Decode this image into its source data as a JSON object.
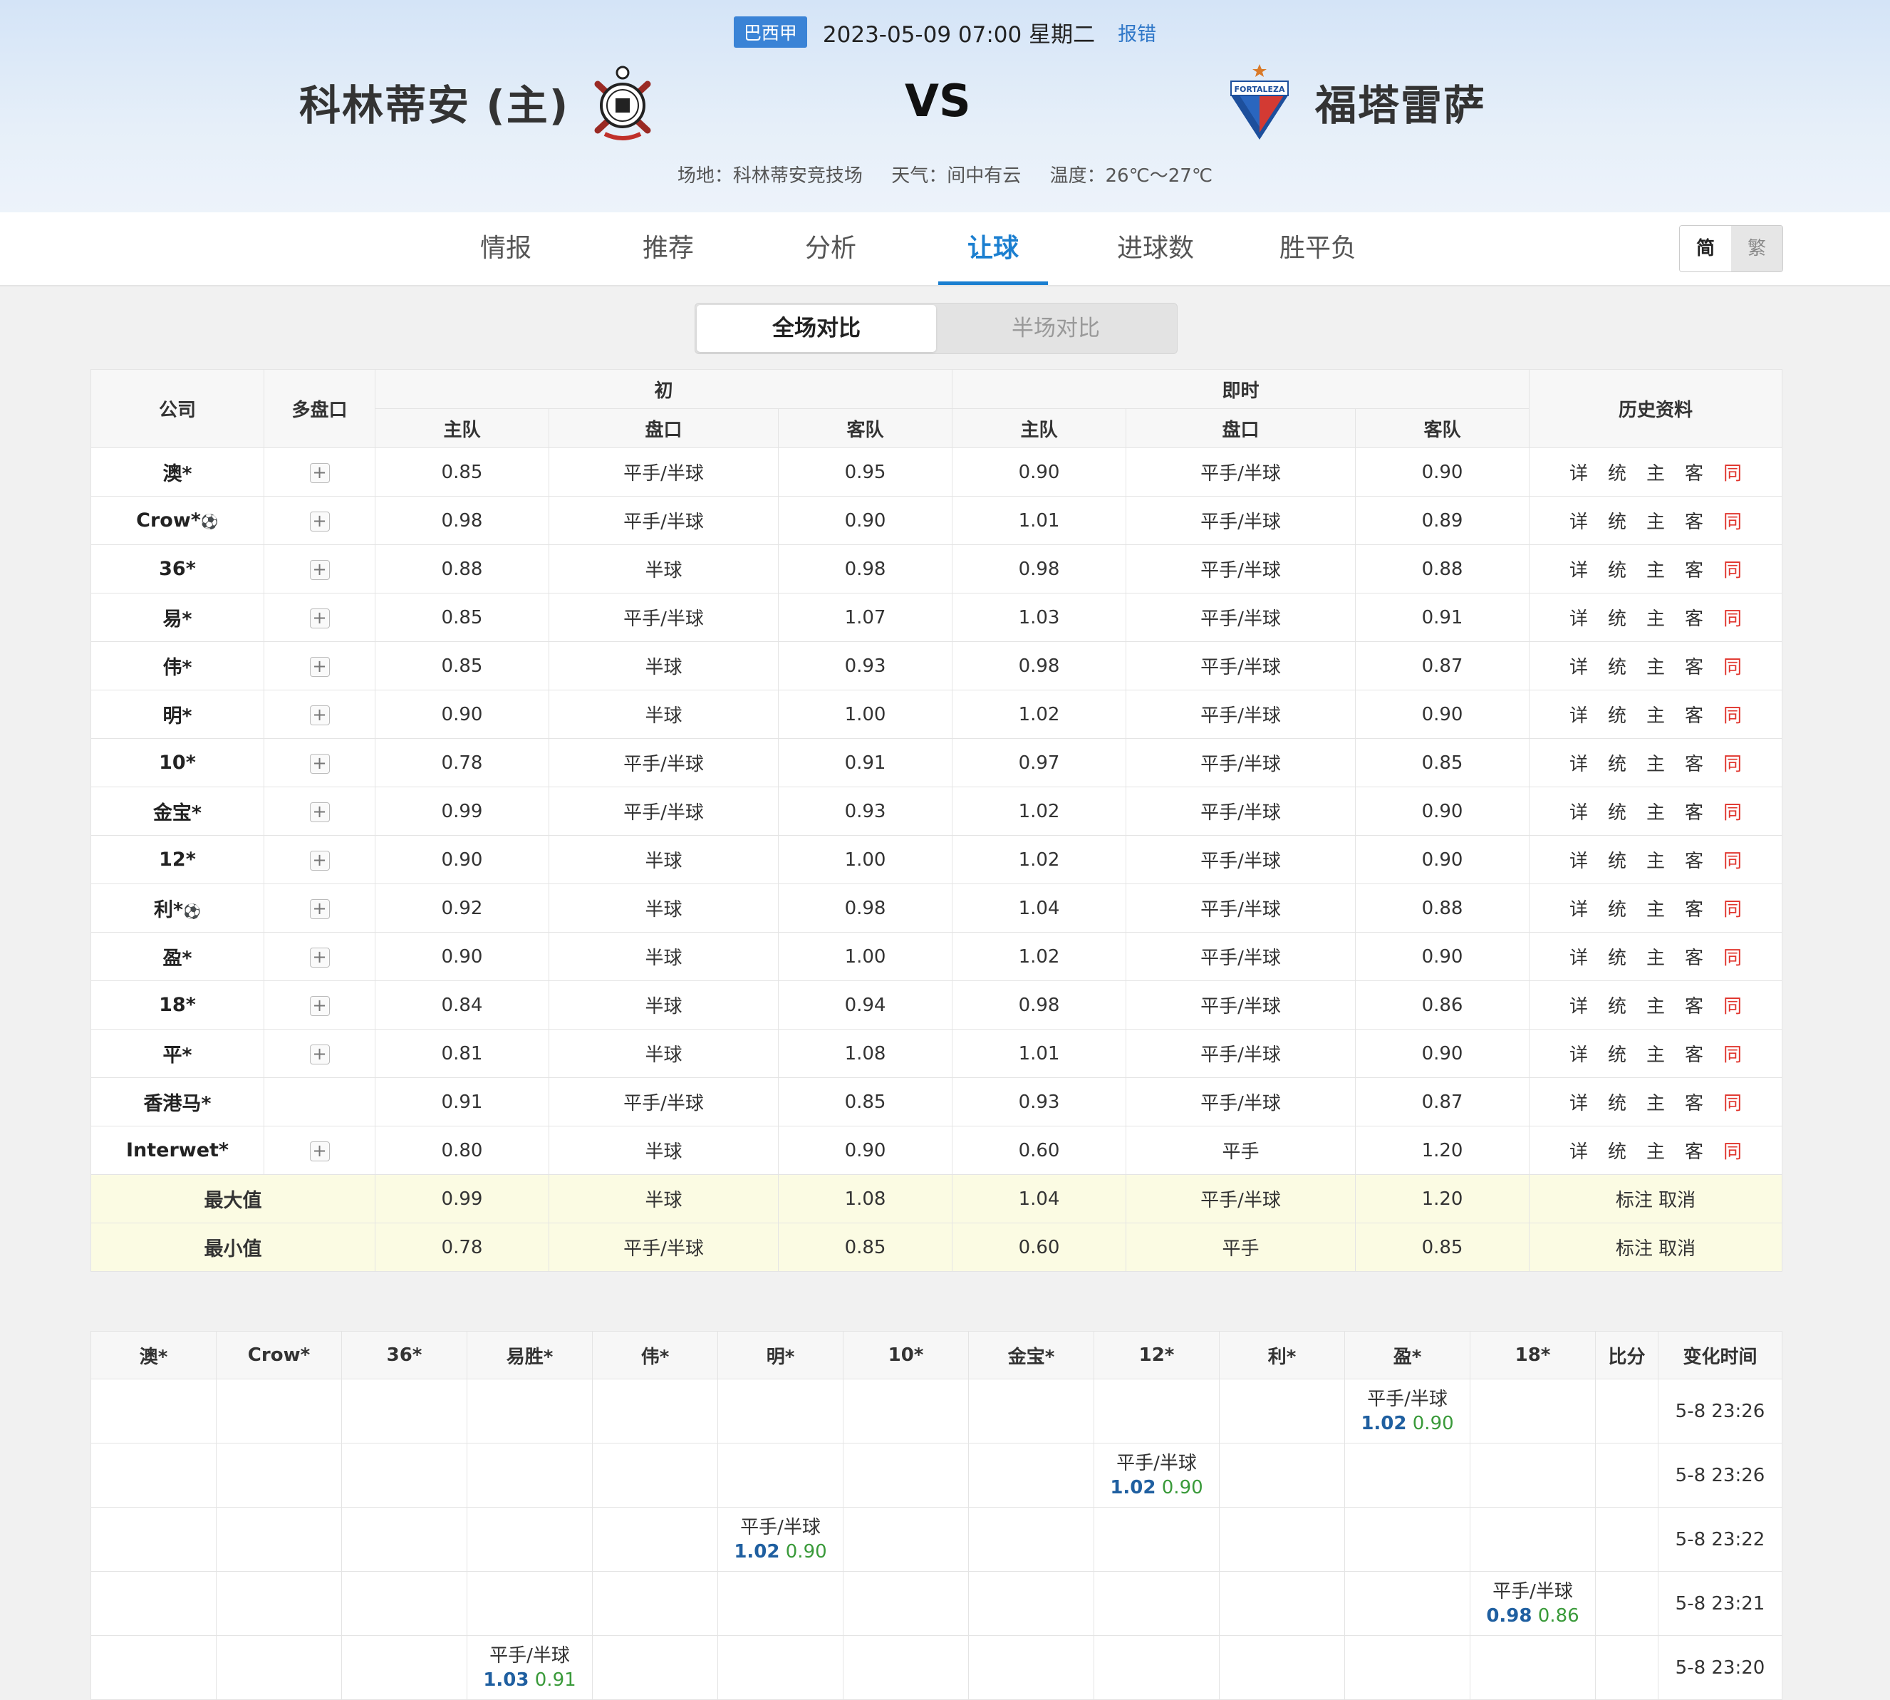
{
  "header": {
    "league": "巴西甲",
    "datetime": "2023-05-09 07:00 星期二",
    "report": "报错",
    "home_team": "科林蒂安 (主)",
    "away_team": "福塔雷萨",
    "vs": "VS",
    "venue": "场地：科林蒂安竞技场",
    "weather": "天气：间中有云",
    "temperature": "温度：26℃～27℃",
    "away_logo_text": "FORTALEZA"
  },
  "nav": {
    "tabs": [
      "情报",
      "推荐",
      "分析",
      "让球",
      "进球数",
      "胜平负"
    ],
    "active_tab": "让球",
    "lang_simplified": "简",
    "lang_traditional": "繁"
  },
  "segment": {
    "full": "全场对比",
    "half": "半场对比"
  },
  "odds_table": {
    "headers": {
      "company": "公司",
      "multi": "多盘口",
      "initial": "初",
      "live": "即时",
      "history": "历史资料",
      "home": "主队",
      "line": "盘口",
      "away": "客队"
    },
    "history_links": [
      "详",
      "统",
      "主",
      "客",
      "同"
    ],
    "rows": [
      {
        "company": "澳*",
        "ball": false,
        "plus": true,
        "i_home": "0.85",
        "i_line": "平手/半球",
        "i_away": "0.95",
        "l_home": "0.90",
        "l_line": "平手/半球",
        "l_away": "0.90"
      },
      {
        "company": "Crow*",
        "ball": true,
        "plus": true,
        "i_home": "0.98",
        "i_line": "平手/半球",
        "i_away": "0.90",
        "l_home": "1.01",
        "l_line": "平手/半球",
        "l_away": "0.89"
      },
      {
        "company": "36*",
        "ball": false,
        "plus": true,
        "i_home": "0.88",
        "i_line": "半球",
        "i_away": "0.98",
        "l_home": "0.98",
        "l_line": "平手/半球",
        "l_away": "0.88"
      },
      {
        "company": "易*",
        "ball": false,
        "plus": true,
        "i_home": "0.85",
        "i_line": "平手/半球",
        "i_away": "1.07",
        "l_home": "1.03",
        "l_line": "平手/半球",
        "l_away": "0.91"
      },
      {
        "company": "伟*",
        "ball": false,
        "plus": true,
        "i_home": "0.85",
        "i_line": "半球",
        "i_away": "0.93",
        "l_home": "0.98",
        "l_line": "平手/半球",
        "l_away": "0.87"
      },
      {
        "company": "明*",
        "ball": false,
        "plus": true,
        "i_home": "0.90",
        "i_line": "半球",
        "i_away": "1.00",
        "l_home": "1.02",
        "l_line": "平手/半球",
        "l_away": "0.90"
      },
      {
        "company": "10*",
        "ball": false,
        "plus": true,
        "i_home": "0.78",
        "i_line": "平手/半球",
        "i_away": "0.91",
        "l_home": "0.97",
        "l_line": "平手/半球",
        "l_away": "0.85"
      },
      {
        "company": "金宝*",
        "ball": false,
        "plus": true,
        "i_home": "0.99",
        "i_line": "平手/半球",
        "i_away": "0.93",
        "l_home": "1.02",
        "l_line": "平手/半球",
        "l_away": "0.90"
      },
      {
        "company": "12*",
        "ball": false,
        "plus": true,
        "i_home": "0.90",
        "i_line": "半球",
        "i_away": "1.00",
        "l_home": "1.02",
        "l_line": "平手/半球",
        "l_away": "0.90"
      },
      {
        "company": "利*",
        "ball": true,
        "plus": true,
        "i_home": "0.92",
        "i_line": "半球",
        "i_away": "0.98",
        "l_home": "1.04",
        "l_line": "平手/半球",
        "l_away": "0.88"
      },
      {
        "company": "盈*",
        "ball": false,
        "plus": true,
        "i_home": "0.90",
        "i_line": "半球",
        "i_away": "1.00",
        "l_home": "1.02",
        "l_line": "平手/半球",
        "l_away": "0.90"
      },
      {
        "company": "18*",
        "ball": false,
        "plus": true,
        "i_home": "0.84",
        "i_line": "半球",
        "i_away": "0.94",
        "l_home": "0.98",
        "l_line": "平手/半球",
        "l_away": "0.86"
      },
      {
        "company": "平*",
        "ball": false,
        "plus": true,
        "i_home": "0.81",
        "i_line": "半球",
        "i_away": "1.08",
        "l_home": "1.01",
        "l_line": "平手/半球",
        "l_away": "0.90"
      },
      {
        "company": "香港马*",
        "ball": false,
        "plus": false,
        "i_home": "0.91",
        "i_line": "平手/半球",
        "i_away": "0.85",
        "l_home": "0.93",
        "l_line": "平手/半球",
        "l_away": "0.87"
      },
      {
        "company": "Interwet*",
        "ball": false,
        "plus": true,
        "i_home": "0.80",
        "i_line": "半球",
        "i_away": "0.90",
        "l_home": "0.60",
        "l_line": "平手",
        "l_away": "1.20"
      }
    ],
    "summary": [
      {
        "label": "最大值",
        "i_home": "0.99",
        "i_line": "半球",
        "i_away": "1.08",
        "l_home": "1.04",
        "l_line": "平手/半球",
        "l_away": "1.20",
        "actions": "标注 取消"
      },
      {
        "label": "最小值",
        "i_home": "0.78",
        "i_line": "平手/半球",
        "i_away": "0.85",
        "l_home": "0.60",
        "l_line": "平手",
        "l_away": "0.85",
        "actions": "标注 取消"
      }
    ]
  },
  "changes_table": {
    "headers": [
      "澳*",
      "Crow*",
      "36*",
      "易胜*",
      "伟*",
      "明*",
      "10*",
      "金宝*",
      "12*",
      "利*",
      "盈*",
      "18*",
      "比分",
      "变化时间"
    ],
    "rows": [
      {
        "col": 10,
        "line": "平手/半球",
        "home": "1.02",
        "away": "0.90",
        "time": "5-8 23:26"
      },
      {
        "col": 8,
        "line": "平手/半球",
        "home": "1.02",
        "away": "0.90",
        "time": "5-8 23:26"
      },
      {
        "col": 5,
        "line": "平手/半球",
        "home": "1.02",
        "away": "0.90",
        "time": "5-8 23:22"
      },
      {
        "col": 11,
        "line": "平手/半球",
        "home": "0.98",
        "away": "0.86",
        "time": "5-8 23:21"
      },
      {
        "col": 3,
        "line": "平手/半球",
        "home": "1.03",
        "away": "0.91",
        "time": "5-8 23:20"
      }
    ]
  }
}
